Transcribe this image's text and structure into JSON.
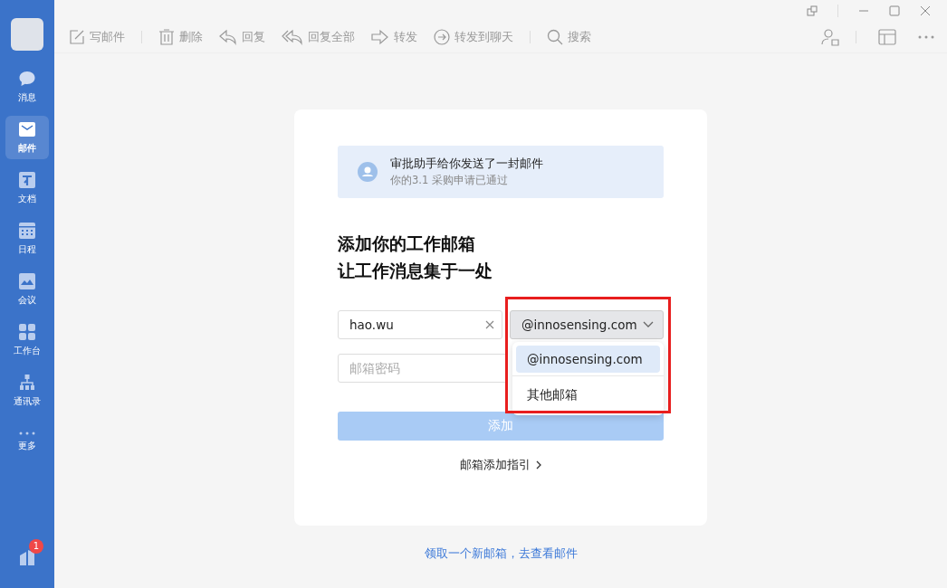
{
  "sidebar": {
    "items": [
      {
        "label": "消息",
        "kind": "chat",
        "selected": false
      },
      {
        "label": "邮件",
        "kind": "mail",
        "selected": true
      },
      {
        "label": "文档",
        "kind": "doc",
        "selected": false
      },
      {
        "label": "日程",
        "kind": "calendar",
        "selected": false
      },
      {
        "label": "会议",
        "kind": "meeting",
        "selected": false
      },
      {
        "label": "工作台",
        "kind": "grid",
        "selected": false
      },
      {
        "label": "通讯录",
        "kind": "org",
        "selected": false
      },
      {
        "label": "更多",
        "kind": "more",
        "selected": false
      }
    ],
    "bottom_badge": "1"
  },
  "toolbar": {
    "items": [
      {
        "label": "写邮件",
        "kind": "compose"
      },
      {
        "label": "删除",
        "kind": "trash"
      },
      {
        "label": "回复",
        "kind": "reply"
      },
      {
        "label": "回复全部",
        "kind": "replyall"
      },
      {
        "label": "转发",
        "kind": "forward"
      },
      {
        "label": "转发到聊天",
        "kind": "chatforward"
      },
      {
        "label": "搜索",
        "kind": "search"
      }
    ]
  },
  "notice": {
    "title": "审批助手给你发送了一封邮件",
    "subtitle": "你的3.1 采购申请已通过"
  },
  "heading_lines": [
    "添加你的工作邮箱",
    "让工作消息集于一处"
  ],
  "form": {
    "username": {
      "value": "hao.wu"
    },
    "domain": {
      "value": "@innosensing.com",
      "expanded": true,
      "options": [
        {
          "label": "@innosensing.com",
          "selected": true
        },
        {
          "label": "其他邮箱",
          "selected": false
        }
      ]
    },
    "password": {
      "placeholder": "邮箱密码"
    },
    "add_button": {
      "label": "添加",
      "disabled": true
    },
    "guide_link": "邮箱添加指引"
  },
  "highlight": true,
  "footer_link": "领取一个新邮箱，去查看邮件"
}
